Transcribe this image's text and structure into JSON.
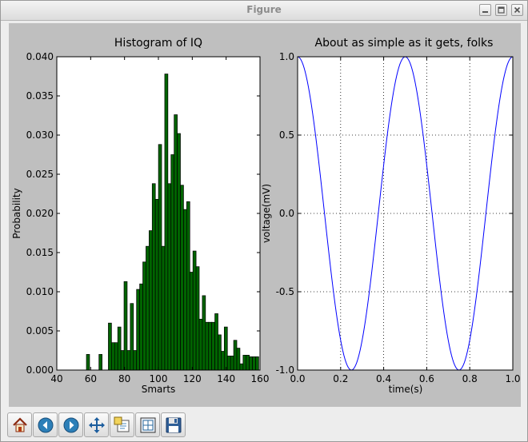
{
  "window": {
    "title": "Figure"
  },
  "toolbar": {
    "buttons": [
      {
        "name": "home-button",
        "icon": "home-icon"
      },
      {
        "name": "back-button",
        "icon": "arrow-left-icon"
      },
      {
        "name": "forward-button",
        "icon": "arrow-right-icon"
      },
      {
        "name": "pan-button",
        "icon": "move-arrows-icon"
      },
      {
        "name": "zoom-button",
        "icon": "zoom-rect-icon"
      },
      {
        "name": "subplots-button",
        "icon": "subplots-icon"
      },
      {
        "name": "save-button",
        "icon": "floppy-disk-icon"
      }
    ]
  },
  "colors": {
    "hist_fill": "#006400",
    "line": "#0000ff",
    "figure_bg": "#bfbfbf"
  },
  "chart_data": [
    {
      "type": "bar",
      "title": "Histogram of IQ",
      "xlabel": "Smarts",
      "ylabel": "Probability",
      "xlim": [
        40,
        160
      ],
      "ylim": [
        0,
        0.04
      ],
      "xticks": [
        "40",
        "60",
        "80",
        "100",
        "120",
        "140",
        "160"
      ],
      "yticks": [
        "0.000",
        "0.005",
        "0.010",
        "0.015",
        "0.020",
        "0.025",
        "0.030",
        "0.035",
        "0.040"
      ],
      "grid": false,
      "bin_start": 57.5,
      "bin_width": 1.85,
      "values": [
        0.002,
        0,
        0,
        0,
        0.002,
        0,
        0,
        0.006,
        0.0035,
        0.0035,
        0.0055,
        0.0025,
        0.0113,
        0.0025,
        0.0085,
        0.0025,
        0.0103,
        0.011,
        0.0138,
        0.0158,
        0.0178,
        0.0238,
        0.0218,
        0.0288,
        0.0158,
        0.0378,
        0.0238,
        0.0275,
        0.0326,
        0.0302,
        0.0236,
        0.0205,
        0.0215,
        0.0125,
        0.0152,
        0.0132,
        0.0065,
        0.0095,
        0.0061,
        0.0061,
        0.0061,
        0.0072,
        0.0045,
        0.0024,
        0.0055,
        0.0018,
        0.0018,
        0.0038,
        0.0028,
        0.0008,
        0.0019,
        0.0019,
        0.0017,
        0.0017,
        0.0017
      ]
    },
    {
      "type": "line",
      "title": "About as simple  as it gets, folks",
      "xlabel": "time(s)",
      "ylabel": "voltage(mV)",
      "xlim": [
        0,
        1
      ],
      "ylim": [
        -1,
        1
      ],
      "xticks": [
        "0.0",
        "0.2",
        "0.4",
        "0.6",
        "0.8",
        "1.0"
      ],
      "yticks": [
        "-1.0",
        "-0.5",
        "0.0",
        "0.5",
        "1.0"
      ],
      "grid": true,
      "function": "cos(4*pi*t)",
      "series": [
        {
          "samples": 200
        }
      ]
    }
  ]
}
